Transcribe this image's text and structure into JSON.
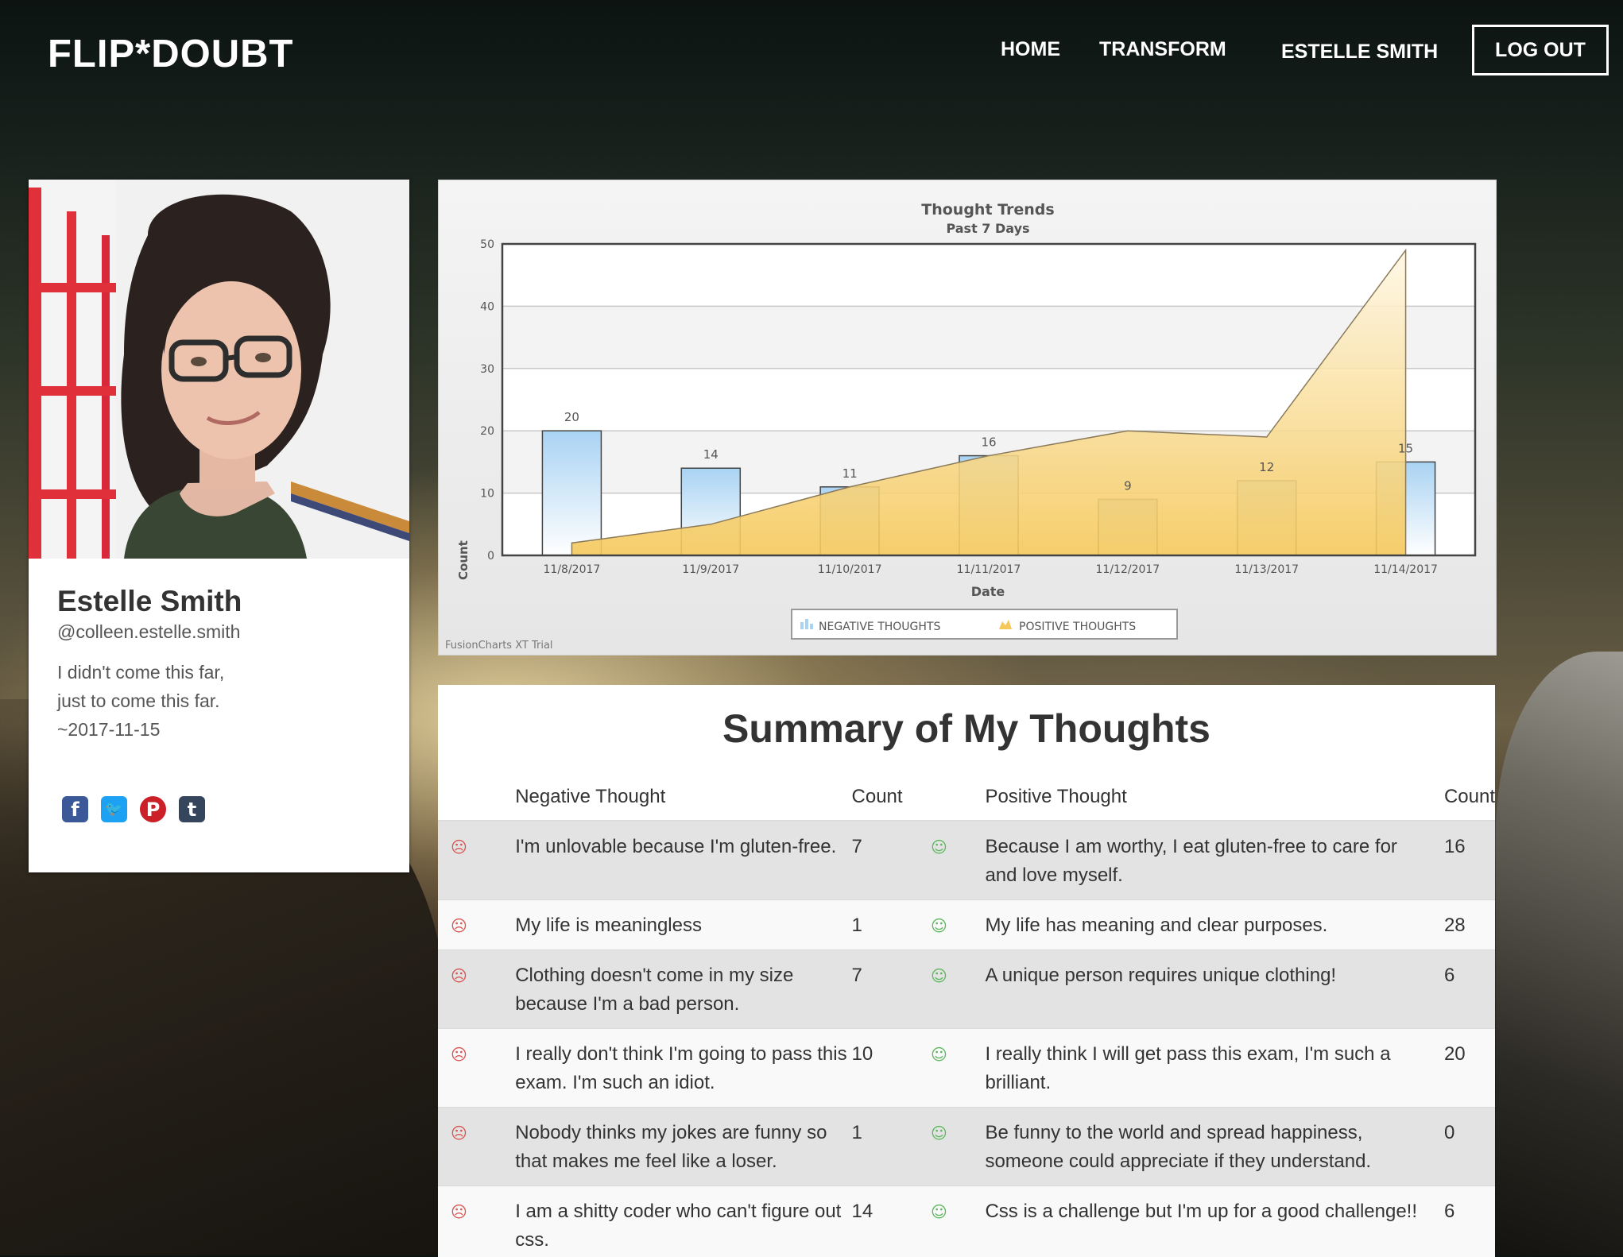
{
  "header": {
    "brand": "FLIP*DOUBT",
    "nav_home": "HOME",
    "nav_transform": "TRANSFORM",
    "nav_user": "ESTELLE SMITH",
    "logout": "LOG OUT"
  },
  "profile": {
    "name": "Estelle Smith",
    "handle": "@colleen.estelle.smith",
    "quote_line1": "I didn't come this far,",
    "quote_line2": "just to come this far.",
    "quote_line3": "~2017-11-15",
    "social_icons": [
      "facebook-icon",
      "twitter-icon",
      "pinterest-icon",
      "tumblr-icon"
    ]
  },
  "chart_data": {
    "type": "bar",
    "title": "Thought Trends",
    "subtitle": "Past 7 Days",
    "xlabel": "Date",
    "ylabel": "Count",
    "ylim": [
      0,
      50
    ],
    "yticks": [
      0,
      10,
      20,
      30,
      40,
      50
    ],
    "categories": [
      "11/8/2017",
      "11/9/2017",
      "11/10/2017",
      "11/11/2017",
      "11/12/2017",
      "11/13/2017",
      "11/14/2017"
    ],
    "series": [
      {
        "name": "NEGATIVE THOUGHTS",
        "type": "bar",
        "values": [
          20,
          14,
          11,
          16,
          9,
          12,
          15
        ],
        "color": "#a9d3f3"
      },
      {
        "name": "POSITIVE THOUGHTS",
        "type": "area",
        "values": [
          2,
          5,
          11,
          16,
          20,
          19,
          49
        ],
        "color": "#f5c95c"
      }
    ],
    "legend": "bottom",
    "watermark": "FusionCharts XT Trial"
  },
  "summary": {
    "title": "Summary of My Thoughts",
    "headers": {
      "negative": "Negative Thought",
      "count1": "Count",
      "positive": "Positive Thought",
      "count2": "Count"
    },
    "rows": [
      {
        "neg": "I'm unlovable because I'm gluten-free.",
        "neg_count": "7",
        "pos": "Because I am worthy, I eat gluten-free to care for and love myself.",
        "pos_count": "16"
      },
      {
        "neg": "My life is meaningless",
        "neg_count": "1",
        "pos": "My life has meaning and clear purposes.",
        "pos_count": "28"
      },
      {
        "neg": "Clothing doesn't come in my size because I'm a bad person.",
        "neg_count": "7",
        "pos": "A unique person requires unique clothing!",
        "pos_count": "6"
      },
      {
        "neg": "I really don't think I'm going to pass this exam. I'm such an idiot.",
        "neg_count": "10",
        "pos": "I really think I will get pass this exam, I'm such a brilliant.",
        "pos_count": "20"
      },
      {
        "neg": "Nobody thinks my jokes are funny so that makes me feel like a loser.",
        "neg_count": "1",
        "pos": "Be funny to the world and spread happiness, someone could appreciate if they understand.",
        "pos_count": "0"
      },
      {
        "neg": "I am a shitty coder who can't figure out css.",
        "neg_count": "14",
        "pos": "Css is a challenge but I'm up for a good challenge!!",
        "pos_count": "6"
      }
    ]
  }
}
